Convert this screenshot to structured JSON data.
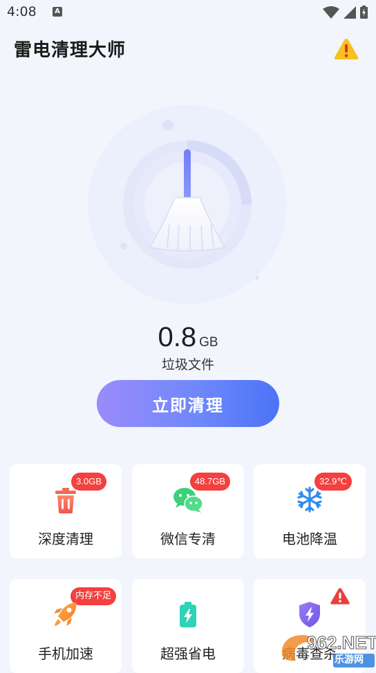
{
  "status_bar": {
    "time": "4:08",
    "notification_letter": "A",
    "icons": [
      "wifi-icon",
      "signal-icon",
      "battery-icon"
    ]
  },
  "header": {
    "title": "雷电清理大师",
    "warning_icon": "warning-icon"
  },
  "hero": {
    "icon": "broom-icon",
    "junk_size_value": "0.8",
    "junk_size_unit": "GB",
    "junk_caption": "垃圾文件",
    "clean_button_label": "立即清理",
    "progress_ring_fraction": 0.25
  },
  "tools": [
    {
      "label": "深度清理",
      "badge": "3.0GB",
      "icon": "trash-icon"
    },
    {
      "label": "微信专清",
      "badge": "48.7GB",
      "icon": "wechat-icon"
    },
    {
      "label": "电池降温",
      "badge": "32.9℃",
      "icon": "snowflake-icon"
    },
    {
      "label": "手机加速",
      "badge": "内存不足",
      "icon": "rocket-icon"
    },
    {
      "label": "超强省电",
      "badge": "",
      "icon": "battery-bolt-icon"
    },
    {
      "label": "病毒查杀",
      "badge": "",
      "icon": "shield-bolt-icon",
      "alert": "warning-icon"
    }
  ],
  "watermark": {
    "brand": "962",
    "suffix": ".NET",
    "subtitle": "乐游网"
  },
  "colors": {
    "background": "#f3f5fd",
    "accent_start": "#9a8bfb",
    "accent_end": "#4b73f7",
    "badge_red": "#f2413f",
    "warning_yellow": "#f7c21e"
  }
}
